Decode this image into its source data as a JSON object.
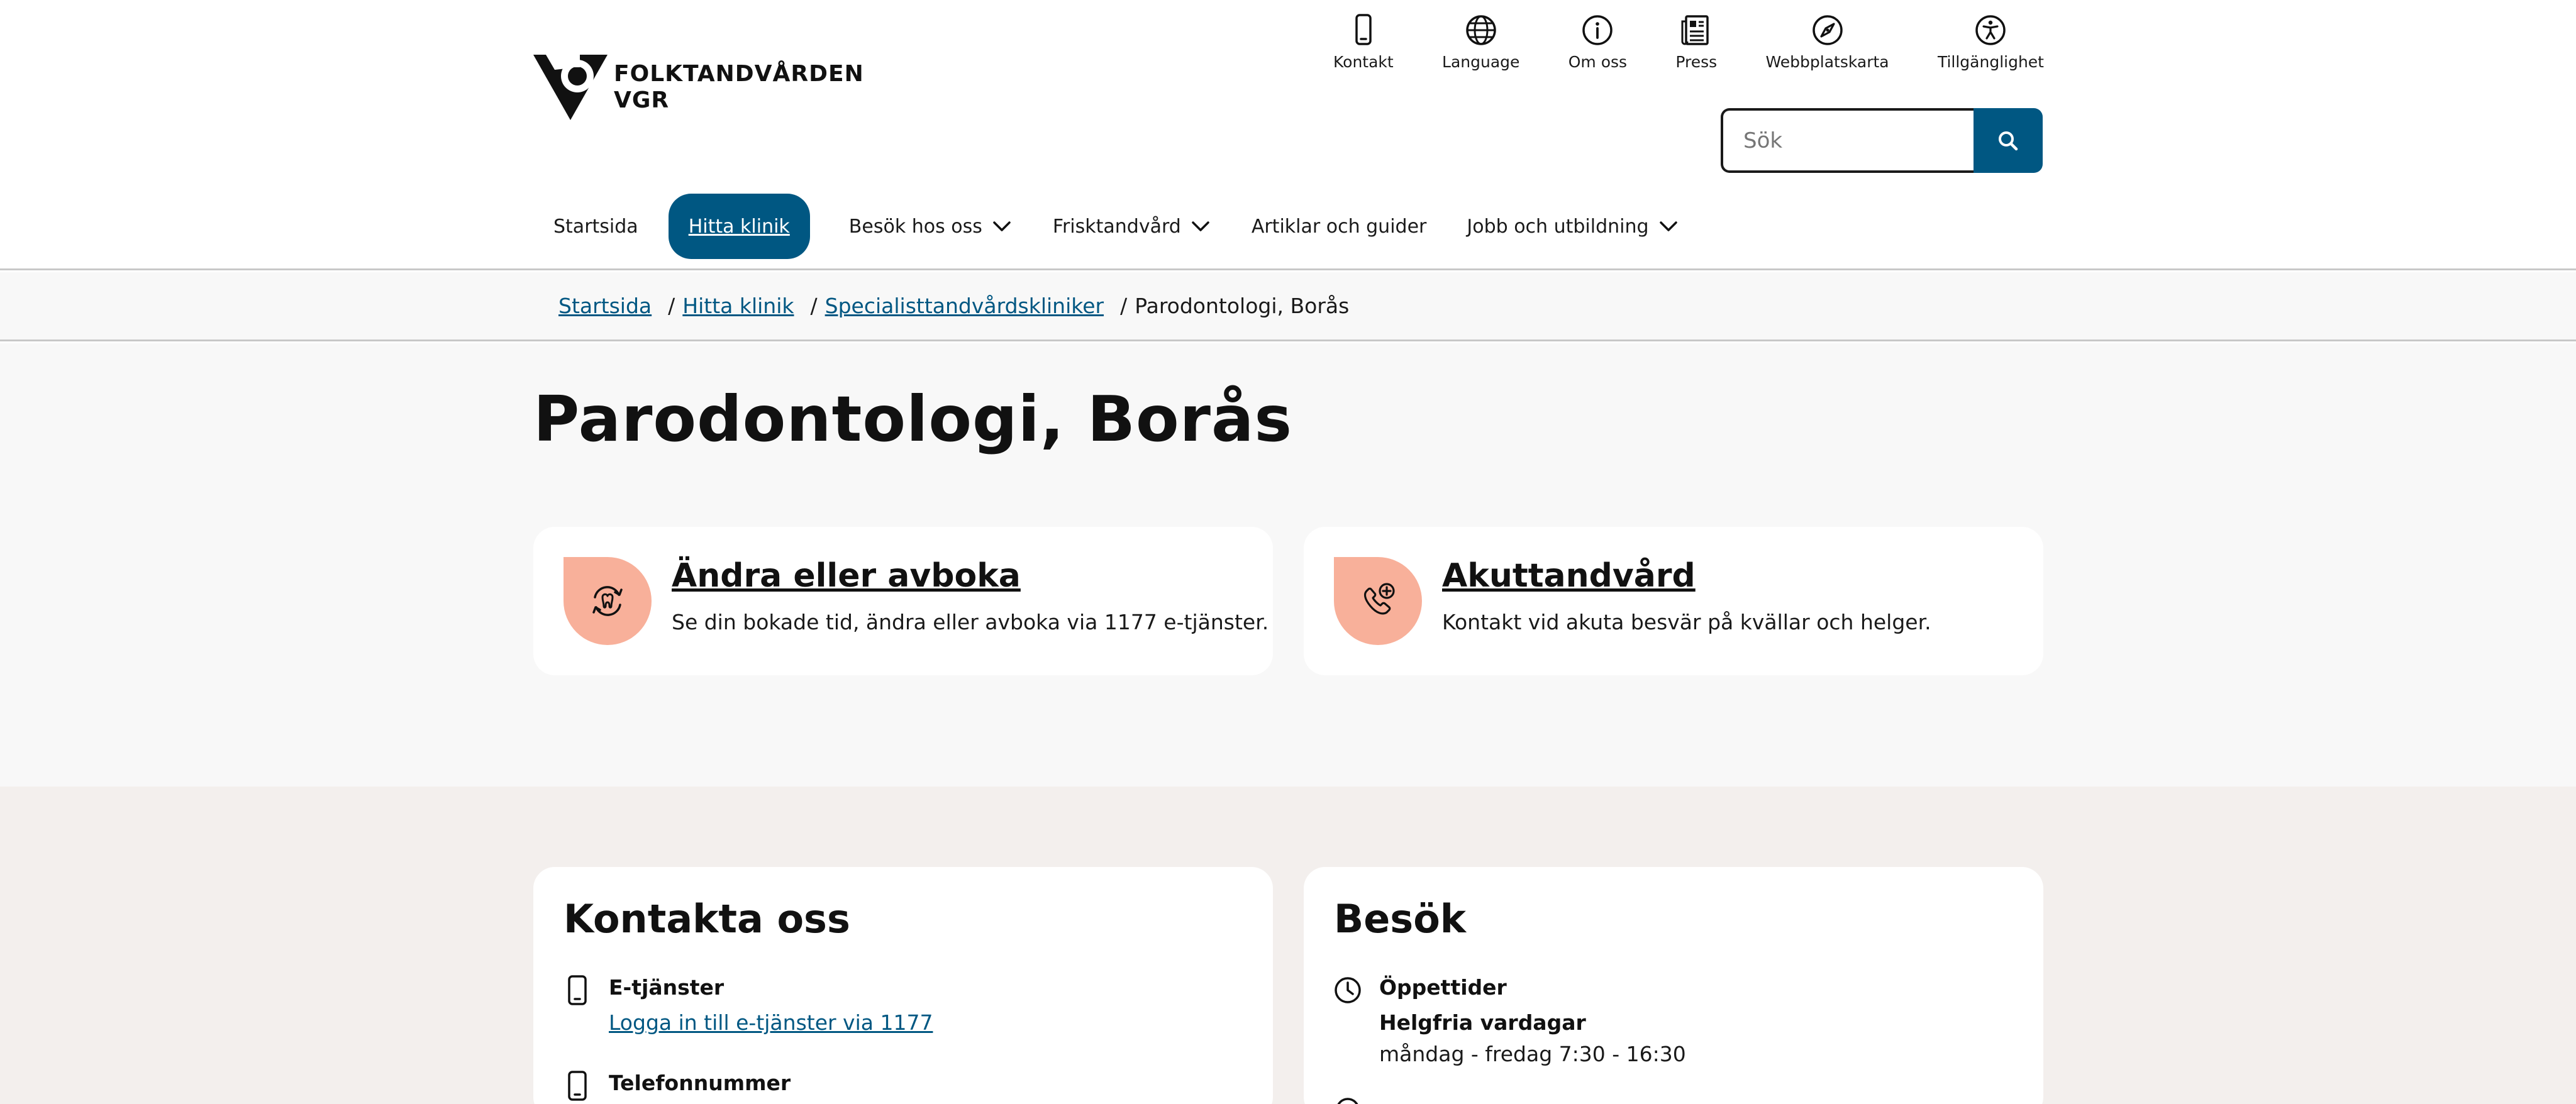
{
  "header": {
    "logo": {
      "line1": "FOLKTANDVÅRDEN",
      "line2": "VGR"
    },
    "utility": [
      {
        "label": "Kontakt",
        "icon": "phone-icon"
      },
      {
        "label": "Language",
        "icon": "globe-icon"
      },
      {
        "label": "Om oss",
        "icon": "info-icon"
      },
      {
        "label": "Press",
        "icon": "newspaper-icon"
      },
      {
        "label": "Webbplatskarta",
        "icon": "compass-icon"
      },
      {
        "label": "Tillgänglighet",
        "icon": "accessibility-icon"
      }
    ],
    "search": {
      "placeholder": "Sök"
    },
    "nav": {
      "startsida": "Startsida",
      "hitta_klinik": "Hitta klinik",
      "besok": "Besök hos oss",
      "frisktandvard": "Frisktandvård",
      "artiklar": "Artiklar och guider",
      "jobb": "Jobb och utbildning"
    }
  },
  "breadcrumb": {
    "items": [
      "Startsida",
      "Hitta klinik",
      "Specialisttandvårdskliniker"
    ],
    "separator": "/",
    "current": "Parodontologi, Borås"
  },
  "hero": {
    "title": "Parodontologi, Borås",
    "cards": [
      {
        "title": "Ändra eller avboka",
        "description": "Se din bokade tid, ändra eller avboka via 1177 e-tjänster.",
        "icon": "calendar-tooth-icon"
      },
      {
        "title": "Akuttandvård",
        "description": "Kontakt vid akuta besvär på kvällar och helger.",
        "icon": "phone-plus-icon"
      }
    ]
  },
  "contact": {
    "title": "Kontakta oss",
    "etjanster_label": "E-tjänster",
    "etjanster_link": "Logga in till e-tjänster via 1177",
    "telefon_label": "Telefonnummer"
  },
  "visit": {
    "title": "Besök",
    "oppettider_label": "Öppettider",
    "helgfria": "Helgfria vardagar",
    "hours": "måndag - fredag 7:30 - 16:30"
  },
  "colors": {
    "accent": "#005782",
    "badge": "#f8b09a",
    "hero_bg": "#f8f8f8",
    "section_bg": "#f3efed"
  }
}
